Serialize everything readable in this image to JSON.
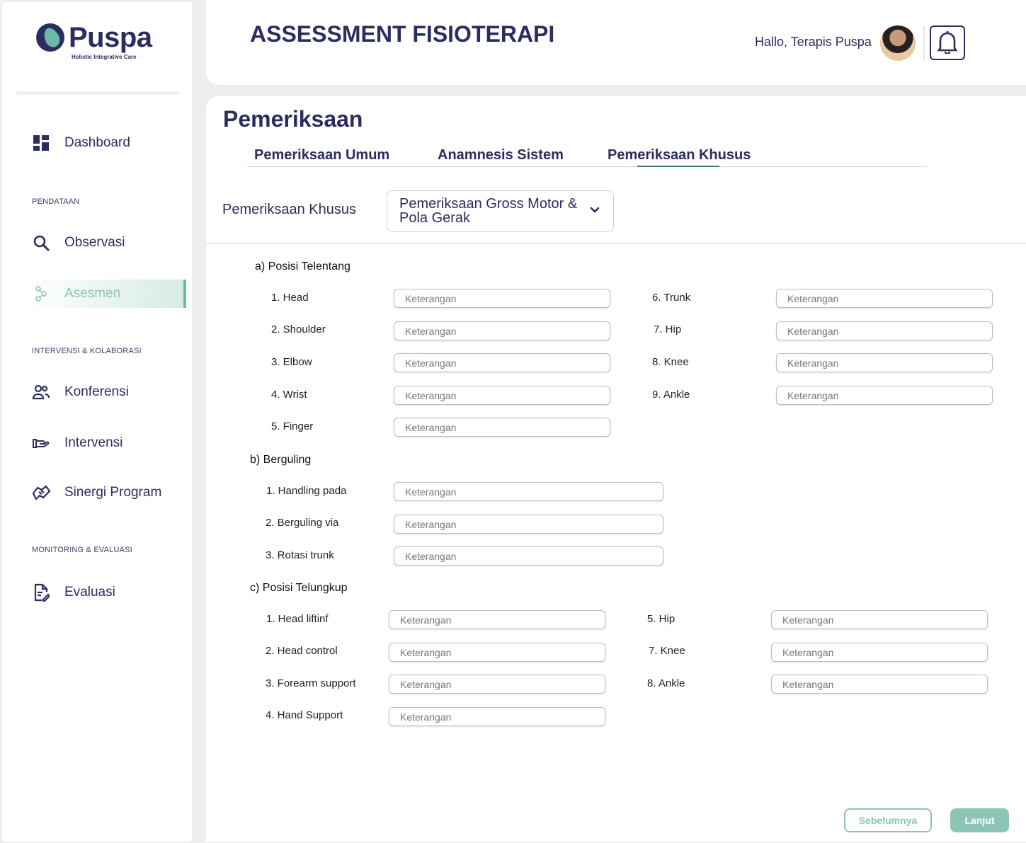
{
  "brand": {
    "name": "Puspa",
    "tagline": "Holistic Integrative Care"
  },
  "sidebar": {
    "items": [
      {
        "label": "Dashboard",
        "icon": "dashboard-icon"
      },
      {
        "label": "Observasi",
        "icon": "search-icon"
      },
      {
        "label": "Asesmen",
        "icon": "assessment-icon",
        "active": true
      },
      {
        "label": "Konferensi",
        "icon": "people-icon"
      },
      {
        "label": "Intervensi",
        "icon": "hand-icon"
      },
      {
        "label": "Sinergi Program",
        "icon": "handshake-icon"
      },
      {
        "label": "Evaluasi",
        "icon": "edit-document-icon"
      }
    ],
    "sections": [
      "PENDATAAN",
      "INTERVENSI & KOLABORASI",
      "MONITORING & EVALUASI"
    ]
  },
  "header": {
    "title": "ASSESSMENT FISIOTERAPI",
    "greeting": "Hallo, Terapis Puspa"
  },
  "main": {
    "section_title": "Pemeriksaan",
    "tabs": [
      {
        "label": "Pemeriksaan Umum"
      },
      {
        "label": "Anamnesis Sistem"
      },
      {
        "label": "Pemeriksaan Khusus",
        "active": true
      }
    ],
    "select": {
      "label": "Pemeriksaan Khusus",
      "value": "Pemeriksaan Gross Motor & Pola Gerak"
    },
    "placeholder": "Keterangan",
    "groups": [
      {
        "title": "a) Posisi Telentang",
        "items": [
          "1. Head",
          "2. Shoulder",
          "3. Elbow",
          "4. Wrist",
          "5. Finger",
          "6. Trunk",
          "7. Hip",
          "8. Knee",
          "9. Ankle"
        ]
      },
      {
        "title": "b) Berguling",
        "items": [
          "1. Handling pada",
          "2. Berguling via",
          "3. Rotasi trunk"
        ]
      },
      {
        "title": "c) Posisi Telungkup",
        "items": [
          "1. Head liftinf",
          "2. Head control",
          "3. Forearm support",
          "4. Hand Support",
          "5. Hip",
          "7. Knee",
          "8. Ankle"
        ]
      }
    ],
    "buttons": {
      "prev": "Sebelumnya",
      "next": "Lanjut"
    }
  },
  "colors": {
    "primary": "#2b2d5e",
    "accent": "#8cc4b6",
    "tab_underline": "#3d7a6a"
  }
}
